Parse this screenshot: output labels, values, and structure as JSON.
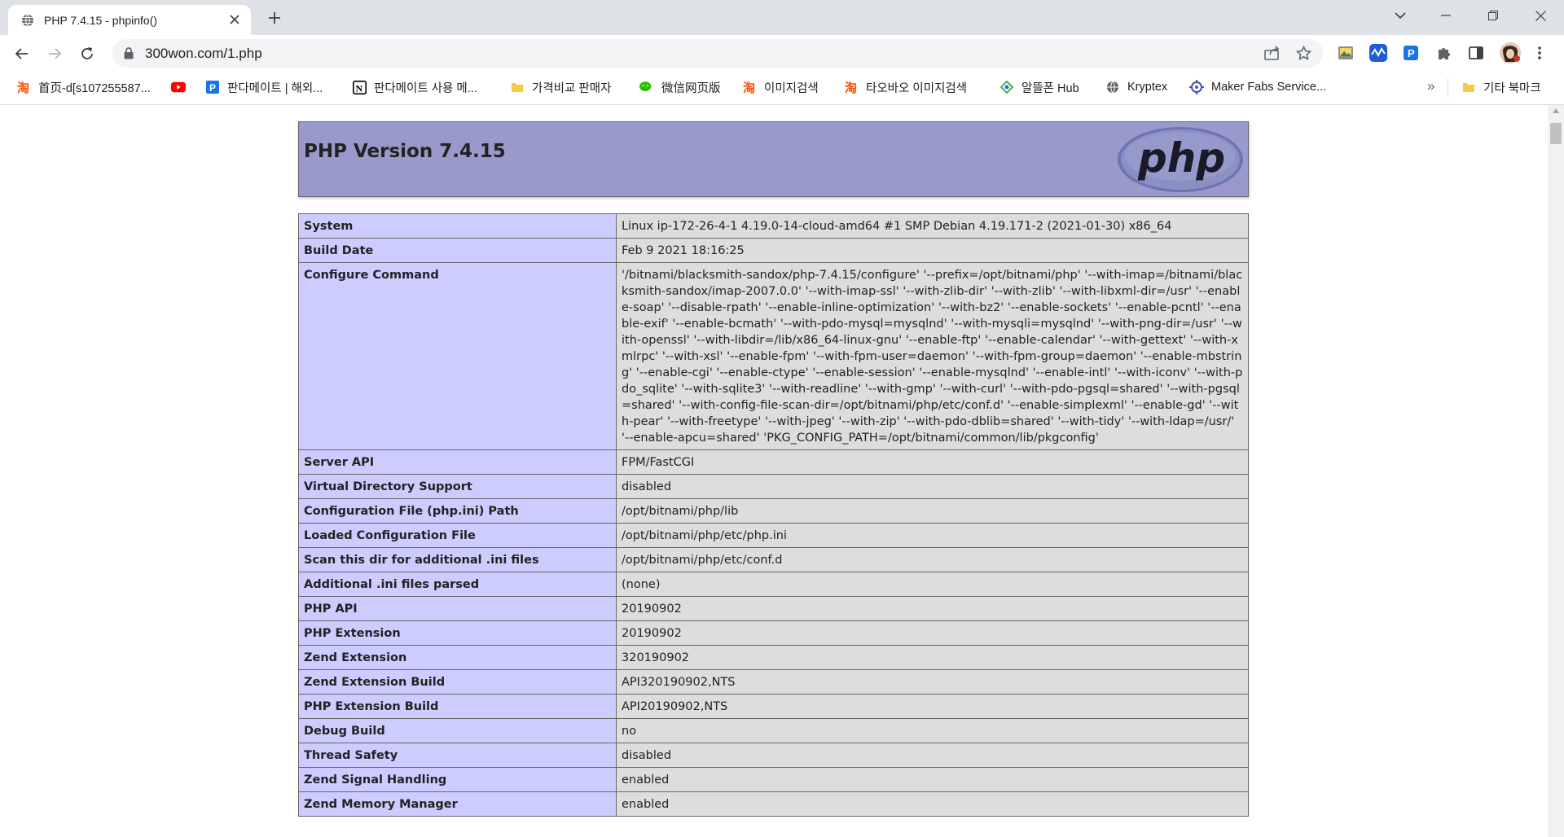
{
  "browser": {
    "tab_title": "PHP 7.4.15 - phpinfo()",
    "url": "300won.com/1.php"
  },
  "bookmarks": [
    {
      "label": "首页-d[s107255587...",
      "icon": "taobao-icon",
      "color": "#ff5000"
    },
    {
      "label": "",
      "icon": "youtube-icon",
      "color": "#ff0000"
    },
    {
      "label": "판다메이트 | 해외...",
      "icon": "pandamate-icon",
      "color": "#1a73e8"
    },
    {
      "label": "판다메이트 사용 메...",
      "icon": "notion-icon",
      "color": "#000000"
    },
    {
      "label": "가격비교 판매자",
      "icon": "folder-icon",
      "color": "#f7c948"
    },
    {
      "label": "微信网页版",
      "icon": "wechat-icon",
      "color": "#2dc100"
    },
    {
      "label": "이미지검색",
      "icon": "taobao-icon",
      "color": "#ff5000"
    },
    {
      "label": "타오바오 이미지검색",
      "icon": "taobao-icon",
      "color": "#ff5000"
    },
    {
      "label": "알뜰폰 Hub",
      "icon": "hub-icon",
      "color": "#4caf50"
    },
    {
      "label": "Kryptex",
      "icon": "globe-icon",
      "color": "#5f6368"
    },
    {
      "label": "Maker Fabs Service...",
      "icon": "makerfabs-icon",
      "color": "#3f51b5"
    }
  ],
  "bookmarks_more": "»",
  "other_bookmarks": "기타 북마크",
  "phpinfo": {
    "title": "PHP Version 7.4.15",
    "logo_text": "php",
    "rows": [
      {
        "key": "System",
        "value": "Linux ip-172-26-4-1 4.19.0-14-cloud-amd64 #1 SMP Debian 4.19.171-2 (2021-01-30) x86_64"
      },
      {
        "key": "Build Date",
        "value": "Feb 9 2021 18:16:25"
      },
      {
        "key": "Configure Command",
        "value": "'/bitnami/blacksmith-sandox/php-7.4.15/configure' '--prefix=/opt/bitnami/php' '--with-imap=/bitnami/blacksmith-sandox/imap-2007.0.0' '--with-imap-ssl' '--with-zlib-dir' '--with-zlib' '--with-libxml-dir=/usr' '--enable-soap' '--disable-rpath' '--enable-inline-optimization' '--with-bz2' '--enable-sockets' '--enable-pcntl' '--enable-exif' '--enable-bcmath' '--with-pdo-mysql=mysqlnd' '--with-mysqli=mysqlnd' '--with-png-dir=/usr' '--with-openssl' '--with-libdir=/lib/x86_64-linux-gnu' '--enable-ftp' '--enable-calendar' '--with-gettext' '--with-xmlrpc' '--with-xsl' '--enable-fpm' '--with-fpm-user=daemon' '--with-fpm-group=daemon' '--enable-mbstring' '--enable-cgi' '--enable-ctype' '--enable-session' '--enable-mysqlnd' '--enable-intl' '--with-iconv' '--with-pdo_sqlite' '--with-sqlite3' '--with-readline' '--with-gmp' '--with-curl' '--with-pdo-pgsql=shared' '--with-pgsql=shared' '--with-config-file-scan-dir=/opt/bitnami/php/etc/conf.d' '--enable-simplexml' '--enable-gd' '--with-pear' '--with-freetype' '--with-jpeg' '--with-zip' '--with-pdo-dblib=shared' '--with-tidy' '--with-ldap=/usr/' '--enable-apcu=shared' 'PKG_CONFIG_PATH=/opt/bitnami/common/lib/pkgconfig'"
      },
      {
        "key": "Server API",
        "value": "FPM/FastCGI"
      },
      {
        "key": "Virtual Directory Support",
        "value": "disabled"
      },
      {
        "key": "Configuration File (php.ini) Path",
        "value": "/opt/bitnami/php/lib"
      },
      {
        "key": "Loaded Configuration File",
        "value": "/opt/bitnami/php/etc/php.ini"
      },
      {
        "key": "Scan this dir for additional .ini files",
        "value": "/opt/bitnami/php/etc/conf.d"
      },
      {
        "key": "Additional .ini files parsed",
        "value": "(none)"
      },
      {
        "key": "PHP API",
        "value": "20190902"
      },
      {
        "key": "PHP Extension",
        "value": "20190902"
      },
      {
        "key": "Zend Extension",
        "value": "320190902"
      },
      {
        "key": "Zend Extension Build",
        "value": "API320190902,NTS"
      },
      {
        "key": "PHP Extension Build",
        "value": "API20190902,NTS"
      },
      {
        "key": "Debug Build",
        "value": "no"
      },
      {
        "key": "Thread Safety",
        "value": "disabled"
      },
      {
        "key": "Zend Signal Handling",
        "value": "enabled"
      },
      {
        "key": "Zend Memory Manager",
        "value": "enabled"
      }
    ]
  }
}
